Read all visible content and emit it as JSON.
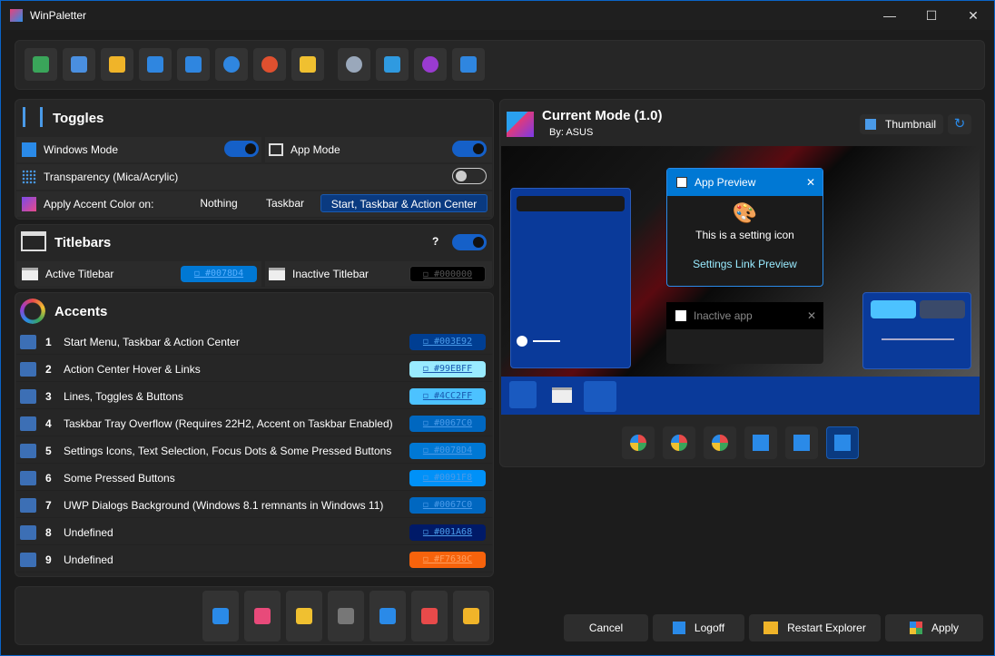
{
  "window": {
    "title": "WinPaletter",
    "controls": [
      "—",
      "☐",
      "✕"
    ]
  },
  "toolbar": {
    "buttons": [
      {
        "name": "new-from-current",
        "color": "#3aa55a"
      },
      {
        "name": "new-from-default",
        "color": "#4a8fe0"
      },
      {
        "name": "open",
        "color": "#f0b429"
      },
      {
        "name": "save",
        "color": "#2f86e0"
      },
      {
        "name": "save-as",
        "color": "#2f86e0"
      },
      {
        "name": "load-current",
        "color": "#2f86e0"
      },
      {
        "name": "load-default",
        "color": "#e0502f"
      },
      {
        "name": "edit",
        "color": "#f0c030"
      },
      {
        "name": "settings",
        "color": "#9aa8bb"
      },
      {
        "name": "update",
        "color": "#2f9ae0"
      },
      {
        "name": "whats-new",
        "color": "#9a3bd0"
      },
      {
        "name": "about",
        "color": "#2f86e0"
      }
    ]
  },
  "toggles": {
    "title": "Toggles",
    "windows_mode": "Windows Mode",
    "app_mode": "App Mode",
    "transparency": "Transparency (Mica/Acrylic)",
    "apply_accent": "Apply Accent Color on:",
    "options": [
      "Nothing",
      "Taskbar",
      "Start, Taskbar & Action Center"
    ],
    "selected": 2,
    "windows_mode_on": true,
    "app_mode_on": true,
    "transparency_on": false
  },
  "titlebars": {
    "title": "Titlebars",
    "help": "?",
    "enabled": true,
    "active_label": "Active Titlebar",
    "active_value": "◻ #0078D4",
    "active_color": "#0078D4",
    "inactive_label": "Inactive Titlebar",
    "inactive_value": "◻ #000000",
    "inactive_color": "#000000"
  },
  "accents": {
    "title": "Accents",
    "items": [
      {
        "num": "1",
        "label": "Start Menu, Taskbar & Action Center",
        "value": "◻ #003E92",
        "color": "#003E92"
      },
      {
        "num": "2",
        "label": "Action Center Hover & Links",
        "value": "◻ #99EBFF",
        "color": "#99EBFF"
      },
      {
        "num": "3",
        "label": "Lines, Toggles & Buttons",
        "value": "◻ #4CC2FF",
        "color": "#4CC2FF"
      },
      {
        "num": "4",
        "label": "Taskbar Tray Overflow (Requires 22H2, Accent on Taskbar Enabled)",
        "value": "◻ #0067C0",
        "color": "#0067C0"
      },
      {
        "num": "5",
        "label": "Settings Icons, Text Selection, Focus Dots & Some Pressed Buttons",
        "value": "◻ #0078D4",
        "color": "#0078D4"
      },
      {
        "num": "6",
        "label": "Some Pressed Buttons",
        "value": "◻ #0091F8",
        "color": "#0091F8"
      },
      {
        "num": "7",
        "label": "UWP Dialogs Background (Windows 8.1 remnants in Windows 11)",
        "value": "◻ #0067C0",
        "color": "#0067C0"
      },
      {
        "num": "8",
        "label": "Undefined",
        "value": "◻ #001A68",
        "color": "#001A68"
      },
      {
        "num": "9",
        "label": "Undefined",
        "value": "◻ #F7630C",
        "color": "#F7630C"
      }
    ]
  },
  "preview": {
    "title": "Current Mode (1.0)",
    "author": "By: ASUS",
    "thumbnail": "Thumbnail",
    "app_preview": "App Preview",
    "setting_icon_text": "This is a setting icon",
    "settings_link": "Settings Link Preview",
    "inactive_app": "Inactive app"
  },
  "os_buttons": [
    "Windows XP",
    "Windows 7",
    "Windows Vista",
    "Windows 8.1",
    "Windows 10",
    "Windows 11"
  ],
  "actions": {
    "cancel": "Cancel",
    "logoff": "Logoff",
    "restart_explorer": "Restart Explorer",
    "apply": "Apply"
  }
}
